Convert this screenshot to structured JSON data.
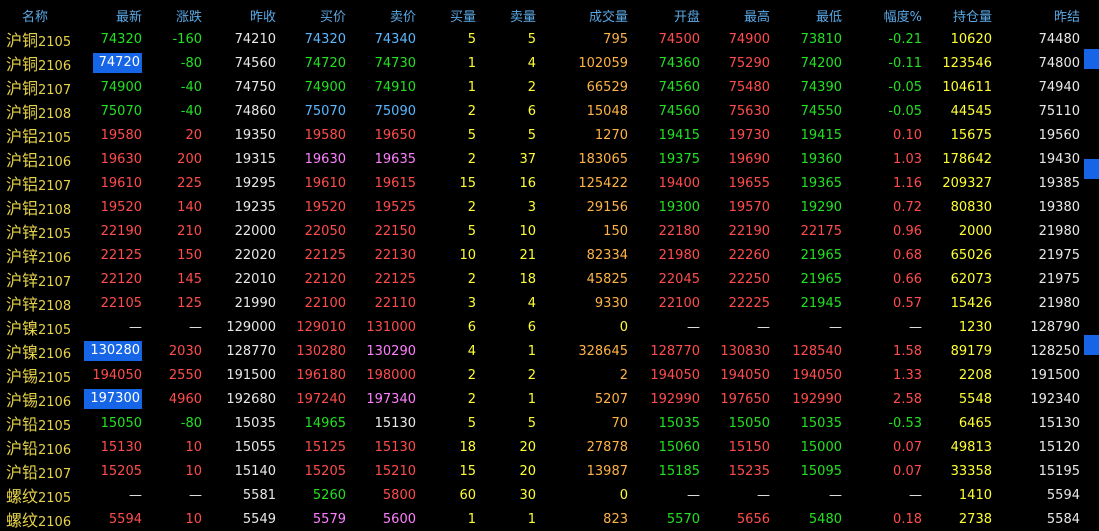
{
  "header": [
    "名称",
    "最新",
    "涨跌",
    "昨收",
    "买价",
    "卖价",
    "买量",
    "卖量",
    "成交量",
    "开盘",
    "最高",
    "最低",
    "幅度%",
    "持仓量",
    "昨结"
  ],
  "rows": [
    {
      "name": "沪铜",
      "code": "2105",
      "cells": [
        [
          "74320",
          "g"
        ],
        [
          "-160",
          "g"
        ],
        [
          "74210",
          "w"
        ],
        [
          "74320",
          "c"
        ],
        [
          "74340",
          "c"
        ],
        [
          "5",
          "y"
        ],
        [
          "5",
          "y"
        ],
        [
          "795",
          "o"
        ],
        [
          "74500",
          "r"
        ],
        [
          "74900",
          "r"
        ],
        [
          "73810",
          "g"
        ],
        [
          "-0.21",
          "g"
        ],
        [
          "10620",
          "y"
        ],
        [
          "74480",
          "w"
        ]
      ]
    },
    {
      "name": "沪铜",
      "code": "2106",
      "cells": [
        [
          "74720",
          "hl"
        ],
        [
          "-80",
          "g"
        ],
        [
          "74560",
          "w"
        ],
        [
          "74720",
          "g"
        ],
        [
          "74730",
          "g"
        ],
        [
          "1",
          "y"
        ],
        [
          "4",
          "y"
        ],
        [
          "102059",
          "o"
        ],
        [
          "74360",
          "g"
        ],
        [
          "75290",
          "r"
        ],
        [
          "74200",
          "g"
        ],
        [
          "-0.11",
          "g"
        ],
        [
          "123546",
          "y"
        ],
        [
          "74800",
          "w"
        ]
      ]
    },
    {
      "name": "沪铜",
      "code": "2107",
      "cells": [
        [
          "74900",
          "g"
        ],
        [
          "-40",
          "g"
        ],
        [
          "74750",
          "w"
        ],
        [
          "74900",
          "g"
        ],
        [
          "74910",
          "g"
        ],
        [
          "1",
          "y"
        ],
        [
          "2",
          "y"
        ],
        [
          "66529",
          "o"
        ],
        [
          "74560",
          "g"
        ],
        [
          "75480",
          "r"
        ],
        [
          "74390",
          "g"
        ],
        [
          "-0.05",
          "g"
        ],
        [
          "104611",
          "y"
        ],
        [
          "74940",
          "w"
        ]
      ]
    },
    {
      "name": "沪铜",
      "code": "2108",
      "cells": [
        [
          "75070",
          "g"
        ],
        [
          "-40",
          "g"
        ],
        [
          "74860",
          "w"
        ],
        [
          "75070",
          "c"
        ],
        [
          "75090",
          "c"
        ],
        [
          "2",
          "y"
        ],
        [
          "6",
          "y"
        ],
        [
          "15048",
          "o"
        ],
        [
          "74560",
          "g"
        ],
        [
          "75630",
          "r"
        ],
        [
          "74550",
          "g"
        ],
        [
          "-0.05",
          "g"
        ],
        [
          "44545",
          "y"
        ],
        [
          "75110",
          "w"
        ]
      ]
    },
    {
      "name": "沪铝",
      "code": "2105",
      "cells": [
        [
          "19580",
          "r"
        ],
        [
          "20",
          "r"
        ],
        [
          "19350",
          "w"
        ],
        [
          "19580",
          "r"
        ],
        [
          "19650",
          "r"
        ],
        [
          "5",
          "y"
        ],
        [
          "5",
          "y"
        ],
        [
          "1270",
          "o"
        ],
        [
          "19415",
          "g"
        ],
        [
          "19730",
          "r"
        ],
        [
          "19415",
          "g"
        ],
        [
          "0.10",
          "r"
        ],
        [
          "15675",
          "y"
        ],
        [
          "19560",
          "w"
        ]
      ]
    },
    {
      "name": "沪铝",
      "code": "2106",
      "cells": [
        [
          "19630",
          "r"
        ],
        [
          "200",
          "r"
        ],
        [
          "19315",
          "w"
        ],
        [
          "19630",
          "p"
        ],
        [
          "19635",
          "p"
        ],
        [
          "2",
          "y"
        ],
        [
          "37",
          "y"
        ],
        [
          "183065",
          "o"
        ],
        [
          "19375",
          "g"
        ],
        [
          "19690",
          "r"
        ],
        [
          "19360",
          "g"
        ],
        [
          "1.03",
          "r"
        ],
        [
          "178642",
          "y"
        ],
        [
          "19430",
          "w"
        ]
      ]
    },
    {
      "name": "沪铝",
      "code": "2107",
      "cells": [
        [
          "19610",
          "r"
        ],
        [
          "225",
          "r"
        ],
        [
          "19295",
          "w"
        ],
        [
          "19610",
          "r"
        ],
        [
          "19615",
          "r"
        ],
        [
          "15",
          "y"
        ],
        [
          "16",
          "y"
        ],
        [
          "125422",
          "o"
        ],
        [
          "19400",
          "r"
        ],
        [
          "19655",
          "r"
        ],
        [
          "19365",
          "g"
        ],
        [
          "1.16",
          "r"
        ],
        [
          "209327",
          "y"
        ],
        [
          "19385",
          "w"
        ]
      ]
    },
    {
      "name": "沪铝",
      "code": "2108",
      "cells": [
        [
          "19520",
          "r"
        ],
        [
          "140",
          "r"
        ],
        [
          "19235",
          "w"
        ],
        [
          "19520",
          "r"
        ],
        [
          "19525",
          "r"
        ],
        [
          "2",
          "y"
        ],
        [
          "3",
          "y"
        ],
        [
          "29156",
          "o"
        ],
        [
          "19300",
          "g"
        ],
        [
          "19570",
          "r"
        ],
        [
          "19290",
          "g"
        ],
        [
          "0.72",
          "r"
        ],
        [
          "80830",
          "y"
        ],
        [
          "19380",
          "w"
        ]
      ]
    },
    {
      "name": "沪锌",
      "code": "2105",
      "cells": [
        [
          "22190",
          "r"
        ],
        [
          "210",
          "r"
        ],
        [
          "22000",
          "w"
        ],
        [
          "22050",
          "r"
        ],
        [
          "22150",
          "r"
        ],
        [
          "5",
          "y"
        ],
        [
          "10",
          "y"
        ],
        [
          "150",
          "o"
        ],
        [
          "22180",
          "r"
        ],
        [
          "22190",
          "r"
        ],
        [
          "22175",
          "r"
        ],
        [
          "0.96",
          "r"
        ],
        [
          "2000",
          "y"
        ],
        [
          "21980",
          "w"
        ]
      ]
    },
    {
      "name": "沪锌",
      "code": "2106",
      "cells": [
        [
          "22125",
          "r"
        ],
        [
          "150",
          "r"
        ],
        [
          "22020",
          "w"
        ],
        [
          "22125",
          "r"
        ],
        [
          "22130",
          "r"
        ],
        [
          "10",
          "y"
        ],
        [
          "21",
          "y"
        ],
        [
          "82334",
          "o"
        ],
        [
          "21980",
          "r"
        ],
        [
          "22260",
          "r"
        ],
        [
          "21965",
          "g"
        ],
        [
          "0.68",
          "r"
        ],
        [
          "65026",
          "y"
        ],
        [
          "21975",
          "w"
        ]
      ]
    },
    {
      "name": "沪锌",
      "code": "2107",
      "cells": [
        [
          "22120",
          "r"
        ],
        [
          "145",
          "r"
        ],
        [
          "22010",
          "w"
        ],
        [
          "22120",
          "r"
        ],
        [
          "22125",
          "r"
        ],
        [
          "2",
          "y"
        ],
        [
          "18",
          "y"
        ],
        [
          "45825",
          "o"
        ],
        [
          "22045",
          "r"
        ],
        [
          "22250",
          "r"
        ],
        [
          "21965",
          "g"
        ],
        [
          "0.66",
          "r"
        ],
        [
          "62073",
          "y"
        ],
        [
          "21975",
          "w"
        ]
      ]
    },
    {
      "name": "沪锌",
      "code": "2108",
      "cells": [
        [
          "22105",
          "r"
        ],
        [
          "125",
          "r"
        ],
        [
          "21990",
          "w"
        ],
        [
          "22100",
          "r"
        ],
        [
          "22110",
          "r"
        ],
        [
          "3",
          "y"
        ],
        [
          "4",
          "y"
        ],
        [
          "9330",
          "o"
        ],
        [
          "22100",
          "r"
        ],
        [
          "22225",
          "r"
        ],
        [
          "21945",
          "g"
        ],
        [
          "0.57",
          "r"
        ],
        [
          "15426",
          "y"
        ],
        [
          "21980",
          "w"
        ]
      ]
    },
    {
      "name": "沪镍",
      "code": "2105",
      "cells": [
        [
          "—",
          "w"
        ],
        [
          "—",
          "w"
        ],
        [
          "129000",
          "w"
        ],
        [
          "129010",
          "r"
        ],
        [
          "131000",
          "r"
        ],
        [
          "6",
          "y"
        ],
        [
          "6",
          "y"
        ],
        [
          "0",
          "y"
        ],
        [
          "—",
          "w"
        ],
        [
          "—",
          "w"
        ],
        [
          "—",
          "w"
        ],
        [
          "—",
          "w"
        ],
        [
          "1230",
          "y"
        ],
        [
          "128790",
          "w"
        ]
      ]
    },
    {
      "name": "沪镍",
      "code": "2106",
      "cells": [
        [
          "130280",
          "hl"
        ],
        [
          "2030",
          "r"
        ],
        [
          "128770",
          "w"
        ],
        [
          "130280",
          "r"
        ],
        [
          "130290",
          "p"
        ],
        [
          "4",
          "y"
        ],
        [
          "1",
          "y"
        ],
        [
          "328645",
          "o"
        ],
        [
          "128770",
          "r"
        ],
        [
          "130830",
          "r"
        ],
        [
          "128540",
          "r"
        ],
        [
          "1.58",
          "r"
        ],
        [
          "89179",
          "y"
        ],
        [
          "128250",
          "w"
        ]
      ]
    },
    {
      "name": "沪锡",
      "code": "2105",
      "cells": [
        [
          "194050",
          "r"
        ],
        [
          "2550",
          "r"
        ],
        [
          "191500",
          "w"
        ],
        [
          "196180",
          "r"
        ],
        [
          "198000",
          "r"
        ],
        [
          "2",
          "y"
        ],
        [
          "2",
          "y"
        ],
        [
          "2",
          "o"
        ],
        [
          "194050",
          "r"
        ],
        [
          "194050",
          "r"
        ],
        [
          "194050",
          "r"
        ],
        [
          "1.33",
          "r"
        ],
        [
          "2208",
          "y"
        ],
        [
          "191500",
          "w"
        ]
      ]
    },
    {
      "name": "沪锡",
      "code": "2106",
      "cells": [
        [
          "197300",
          "hl"
        ],
        [
          "4960",
          "r"
        ],
        [
          "192680",
          "w"
        ],
        [
          "197240",
          "r"
        ],
        [
          "197340",
          "p"
        ],
        [
          "2",
          "y"
        ],
        [
          "1",
          "y"
        ],
        [
          "5207",
          "o"
        ],
        [
          "192990",
          "r"
        ],
        [
          "197650",
          "r"
        ],
        [
          "192990",
          "r"
        ],
        [
          "2.58",
          "r"
        ],
        [
          "5548",
          "y"
        ],
        [
          "192340",
          "w"
        ]
      ]
    },
    {
      "name": "沪铅",
      "code": "2105",
      "cells": [
        [
          "15050",
          "g"
        ],
        [
          "-80",
          "g"
        ],
        [
          "15035",
          "w"
        ],
        [
          "14965",
          "g"
        ],
        [
          "15130",
          "w"
        ],
        [
          "5",
          "y"
        ],
        [
          "5",
          "y"
        ],
        [
          "70",
          "o"
        ],
        [
          "15035",
          "g"
        ],
        [
          "15050",
          "g"
        ],
        [
          "15035",
          "g"
        ],
        [
          "-0.53",
          "g"
        ],
        [
          "6465",
          "y"
        ],
        [
          "15130",
          "w"
        ]
      ]
    },
    {
      "name": "沪铅",
      "code": "2106",
      "cells": [
        [
          "15130",
          "r"
        ],
        [
          "10",
          "r"
        ],
        [
          "15055",
          "w"
        ],
        [
          "15125",
          "r"
        ],
        [
          "15130",
          "r"
        ],
        [
          "18",
          "y"
        ],
        [
          "20",
          "y"
        ],
        [
          "27878",
          "o"
        ],
        [
          "15060",
          "g"
        ],
        [
          "15150",
          "r"
        ],
        [
          "15000",
          "g"
        ],
        [
          "0.07",
          "r"
        ],
        [
          "49813",
          "y"
        ],
        [
          "15120",
          "w"
        ]
      ]
    },
    {
      "name": "沪铅",
      "code": "2107",
      "cells": [
        [
          "15205",
          "r"
        ],
        [
          "10",
          "r"
        ],
        [
          "15140",
          "w"
        ],
        [
          "15205",
          "r"
        ],
        [
          "15210",
          "r"
        ],
        [
          "15",
          "y"
        ],
        [
          "20",
          "y"
        ],
        [
          "13987",
          "o"
        ],
        [
          "15185",
          "g"
        ],
        [
          "15235",
          "r"
        ],
        [
          "15095",
          "g"
        ],
        [
          "0.07",
          "r"
        ],
        [
          "33358",
          "y"
        ],
        [
          "15195",
          "w"
        ]
      ]
    },
    {
      "name": "螺纹",
      "code": "2105",
      "cells": [
        [
          "—",
          "w"
        ],
        [
          "—",
          "w"
        ],
        [
          "5581",
          "w"
        ],
        [
          "5260",
          "g"
        ],
        [
          "5800",
          "r"
        ],
        [
          "60",
          "y"
        ],
        [
          "30",
          "y"
        ],
        [
          "0",
          "y"
        ],
        [
          "—",
          "w"
        ],
        [
          "—",
          "w"
        ],
        [
          "—",
          "w"
        ],
        [
          "—",
          "w"
        ],
        [
          "1410",
          "y"
        ],
        [
          "5594",
          "w"
        ]
      ]
    },
    {
      "name": "螺纹",
      "code": "2106",
      "cells": [
        [
          "5594",
          "r"
        ],
        [
          "10",
          "r"
        ],
        [
          "5549",
          "w"
        ],
        [
          "5579",
          "p"
        ],
        [
          "5600",
          "p"
        ],
        [
          "1",
          "y"
        ],
        [
          "1",
          "y"
        ],
        [
          "823",
          "o"
        ],
        [
          "5570",
          "g"
        ],
        [
          "5656",
          "r"
        ],
        [
          "5480",
          "g"
        ],
        [
          "0.18",
          "r"
        ],
        [
          "2738",
          "y"
        ],
        [
          "5584",
          "w"
        ]
      ]
    }
  ],
  "markers": [
    2,
    7,
    15
  ]
}
